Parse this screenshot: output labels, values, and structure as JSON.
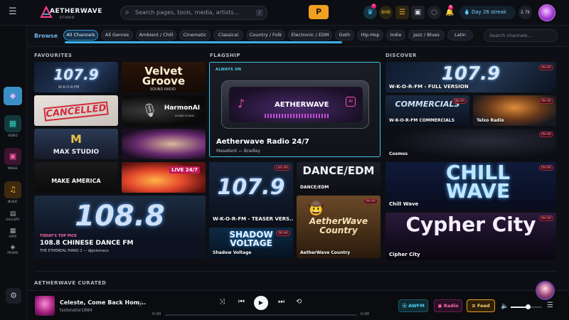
{
  "app": {
    "logo_name": "AETHERWAVE",
    "logo_sub": "STUDIO",
    "search_placeholder": "Search pages, tools, media, artists...",
    "search_kbd": "/",
    "premium_label": "P",
    "streak": "Day 26 streak",
    "points": "2.7k",
    "notif_count": "9",
    "small_badge": "BHB"
  },
  "sidebar": {
    "items": [
      {
        "label": "VIDEO"
      },
      {
        "label": "IMAGE"
      },
      {
        "label": "MUSIC"
      },
      {
        "label": "GALLERY"
      },
      {
        "label": "APPS"
      },
      {
        "label": "PROMS"
      }
    ]
  },
  "browse": {
    "label": "Browse",
    "chips": [
      "All Channels",
      "All Genres",
      "Ambient / Chill",
      "Cinematic",
      "Classical",
      "Country / Folk",
      "Electronic / EDM",
      "Goth",
      "Hip-Hop",
      "Indie",
      "Jazz / Blues",
      "Latin"
    ],
    "channel_search_placeholder": "Search channels..."
  },
  "columns": {
    "favourites": "FAVOURITES",
    "flagship": "FLAGSHIP",
    "discover": "DISCOVER",
    "curated": "AETHERWAVE CURATED"
  },
  "favourites": {
    "tiles": [
      {
        "text": "107.9",
        "sub": "W-K-O-R-FM"
      },
      {
        "text": "Velvet Groove",
        "sub": "SOUND RADIO"
      },
      {
        "text": "CANCELLED"
      },
      {
        "text": "HarmonAI",
        "sub": "SOUND STUDIO"
      },
      {
        "text": "MAX STUDIO"
      },
      {
        "text": ""
      },
      {
        "text": "MAKE AMERICA"
      },
      {
        "text": "LIVE 24/7"
      }
    ],
    "top_pick": {
      "kicker": "TODAY'S TOP PICK",
      "big": "108.8",
      "title": "108.8 CHINESE DANCE FM",
      "subtitle": "THE ETHEREAL PIANO 3 — djpolomaco"
    }
  },
  "flagship": {
    "always_on": "ALWAYS ON",
    "device_logo": "AETHERWAVE",
    "title": "Aetherwave Radio 24/7",
    "byline": "MaseKent — Bradley",
    "tiles": [
      {
        "big": "107.9",
        "caption": "W-K-O-R-FM - TEASER VERS...",
        "tag": "LIVE AIR"
      },
      {
        "big": "DANCE/EDM",
        "caption": "DANCE/EDM"
      },
      {
        "big": "SHADOW VOLTAGE",
        "caption": "Shadow Voltage",
        "tag": "ON AIR"
      },
      {
        "big": "AetherWave Country",
        "caption": "AetherWave Country",
        "tag": "ON AIR"
      }
    ]
  },
  "discover": {
    "tiles": [
      {
        "big": "107.9",
        "caption": "W-K-O-R-FM - FULL VERSION",
        "tag": "ON AIR"
      },
      {
        "big": "COMMERCIALS",
        "caption": "W-K-O-R-FM COMMERCIALS",
        "tag": "ON AIR"
      },
      {
        "big": "",
        "caption": "Telxo Radio",
        "tag": "ON AIR"
      },
      {
        "big": "",
        "caption": "Cosmos",
        "tag": "ON AIR"
      },
      {
        "big": "CHILL WAVE",
        "caption": "Chill Wave",
        "tag": "ON AIR"
      },
      {
        "big": "Cypher City",
        "caption": "Cipher City",
        "tag": "ON AIR"
      }
    ]
  },
  "player": {
    "title": "Celeste, Come Back Hom...",
    "artist": "tsolonator1884",
    "time_current": "0:00",
    "time_total": "0:00",
    "btn_awfm": "AWFM",
    "btn_radio": "Radio",
    "btn_feed": "Feed",
    "volume": 0.55
  },
  "colors": {
    "accent": "#3ab0e8",
    "active_chip": "#16324a",
    "feed": "#f0a020",
    "live_tag": "#ff9db1"
  }
}
